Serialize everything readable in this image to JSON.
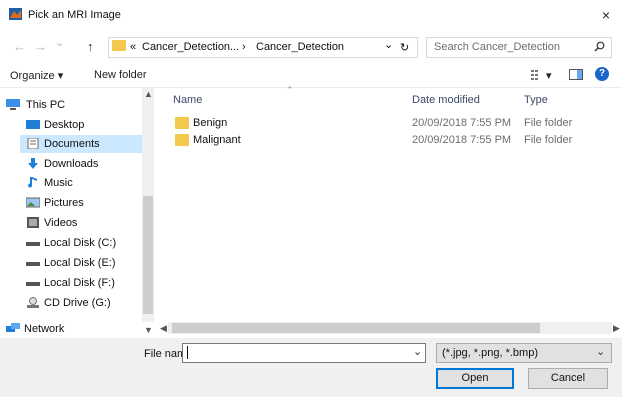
{
  "window": {
    "title": "Pick an MRI Image",
    "close_glyph": "×"
  },
  "nav": {
    "back": "←",
    "forward": "→",
    "dropdown": "⌄",
    "up": "↑",
    "breadcrumb": [
      "«",
      "Cancer_Detection...",
      "›",
      "Cancer_Detection"
    ],
    "address_dropdown": "⌄",
    "refresh": "↻",
    "search_placeholder": "Search Cancer_Detection"
  },
  "toolbar": {
    "organize": "Organize ▾",
    "new_folder": "New folder",
    "view": "▾"
  },
  "sidebar": {
    "items": [
      {
        "label": "This PC",
        "icon": "computer-icon"
      },
      {
        "label": "Desktop",
        "icon": "desktop-icon"
      },
      {
        "label": "Documents",
        "icon": "documents-icon",
        "selected": true
      },
      {
        "label": "Downloads",
        "icon": "downloads-icon"
      },
      {
        "label": "Music",
        "icon": "music-icon"
      },
      {
        "label": "Pictures",
        "icon": "pictures-icon"
      },
      {
        "label": "Videos",
        "icon": "videos-icon"
      },
      {
        "label": "Local Disk (C:)",
        "icon": "drive-icon"
      },
      {
        "label": "Local Disk (E:)",
        "icon": "drive-icon"
      },
      {
        "label": "Local Disk (F:)",
        "icon": "drive-icon"
      },
      {
        "label": "CD Drive (G:)",
        "icon": "cd-drive-icon"
      },
      {
        "label": "Network",
        "icon": "network-icon"
      }
    ]
  },
  "file_list": {
    "columns": {
      "name": "Name",
      "date": "Date modified",
      "type": "Type"
    },
    "rows": [
      {
        "name": "Benign",
        "date": "20/09/2018 7:55 PM",
        "type": "File folder"
      },
      {
        "name": "Malignant",
        "date": "20/09/2018 7:55 PM",
        "type": "File folder"
      }
    ]
  },
  "footer": {
    "file_name_label": "File name:",
    "file_name_value": "",
    "filter": "(*.jpg, *.png, *.bmp)",
    "open": "Open",
    "cancel": "Cancel"
  },
  "colors": {
    "selection": "#cce8ff",
    "folder": "#f3c94d",
    "accent": "#0078d7"
  }
}
